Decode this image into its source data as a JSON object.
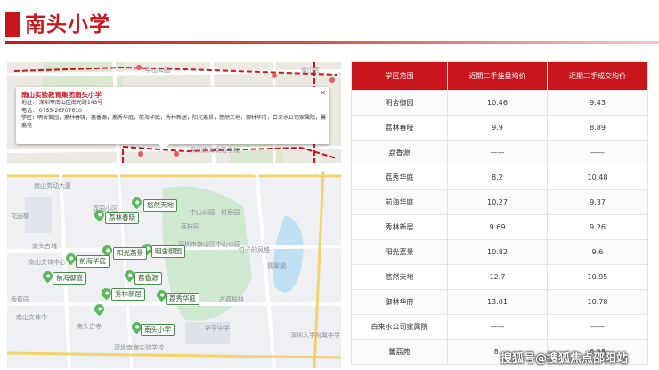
{
  "header": {
    "title": "南头小学"
  },
  "map_top": {
    "popup": {
      "title": "南山实验教育集团南头小学",
      "address": "地址： 深圳市南山区南光路143号",
      "phone": "电话： 0755-26707610",
      "district": "学区：明舍御园，荔林春晓，荔香源，荔秀华庭，前海华庭，秀林新居，阳光荔景，悠然天地，御林华府，白来水公司家属院，馨",
      "district_cont": "荔苑"
    },
    "labels": [
      "中山公园",
      "南山区",
      "深圳南海实验学校"
    ]
  },
  "map_bottom": {
    "markers": [
      "悠然天地",
      "荔林春晓",
      "明舍御园",
      "阳光荔景",
      "前海华庭",
      "荔香源",
      "前海御庭",
      "秀林新居",
      "荔秀华庭",
      "南头小学"
    ],
    "labels": [
      "南山劳动大厦",
      "花园楼",
      "中山公园",
      "村居园",
      "荔枝园",
      "竹子的风格",
      "翡翠湖",
      "深圳市南山区中山公园",
      "深圳大学附属中学",
      "南头古城",
      "南山文体中心",
      "荔园小区",
      "香蕉园",
      "古荔枝林",
      "南头古寺",
      "深圳南海实验学校",
      "南山文体中",
      "华亨中学"
    ]
  },
  "table": {
    "headers": [
      "学区范围",
      "近期二手挂盘均价",
      "近期二手成交均价"
    ],
    "rows": [
      [
        "明舍御园",
        "10.46",
        "9.43"
      ],
      [
        "荔林春晓",
        "9.9",
        "8.89"
      ],
      [
        "荔香源",
        "——",
        "——"
      ],
      [
        "荔秀华庭",
        "8.2",
        "10.48"
      ],
      [
        "前海华庭",
        "10.27",
        "9.37"
      ],
      [
        "秀林新居",
        "9.69",
        "9.26"
      ],
      [
        "阳光荔景",
        "10.82",
        "9.6"
      ],
      [
        "悠然天地",
        "12.7",
        "10.95"
      ],
      [
        "御林华府",
        "13.01",
        "10.78"
      ],
      [
        "白来水公司家属院",
        "——",
        "——"
      ],
      [
        "馨荔苑",
        "8.",
        "6.58"
      ]
    ]
  },
  "watermark": "搜狐号@搜狐焦点邵阳站",
  "colors": {
    "brand_red": "#c9161d",
    "pin_green": "#5cb85c"
  }
}
